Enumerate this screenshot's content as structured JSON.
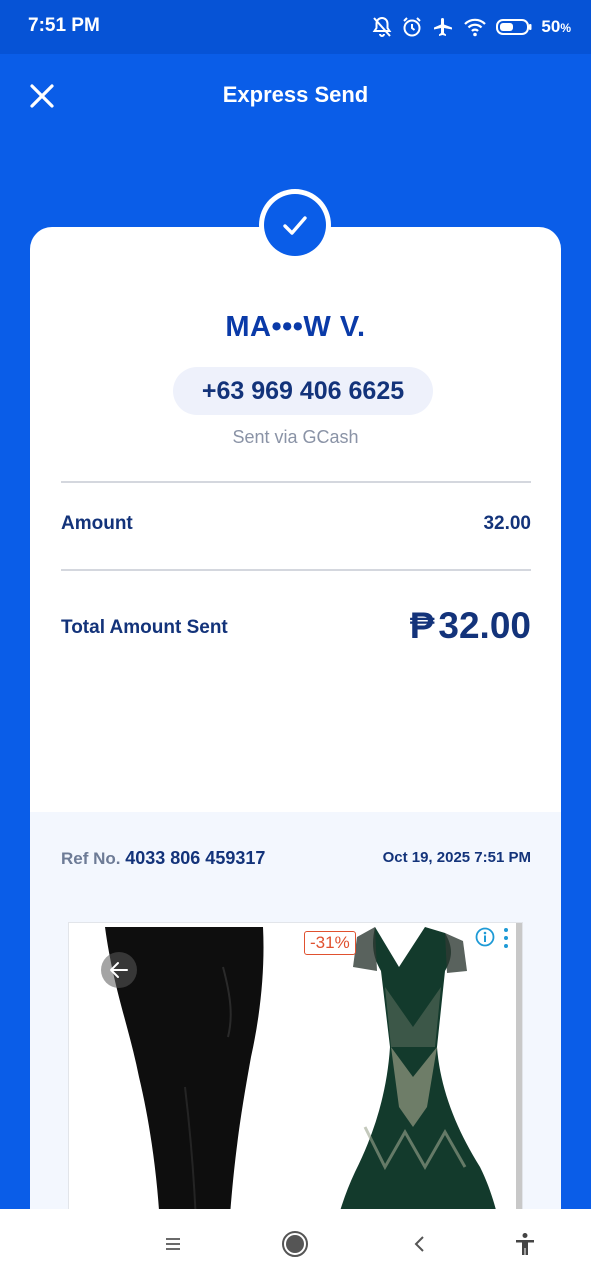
{
  "status_bar": {
    "time": "7:51 PM",
    "battery": "50",
    "battery_unit": "%"
  },
  "header": {
    "title": "Express Send"
  },
  "recipient": {
    "name": "MA•••W V.",
    "phone": "+63 969 406 6625",
    "sent_via": "Sent via GCash"
  },
  "amount_row": {
    "label": "Amount",
    "value": "32.00"
  },
  "total_row": {
    "label": "Total Amount Sent",
    "currency": "₱",
    "value": "32.00"
  },
  "reference": {
    "label": "Ref No.",
    "number": "4033 806 459317",
    "datetime": "Oct 19, 2025 7:51 PM"
  },
  "ad": {
    "discount": "-31%"
  },
  "icons": {
    "close": "close-icon",
    "check": "check-icon",
    "info": "info-icon",
    "menu": "more-vertical-icon",
    "back_arrow": "arrow-left-icon"
  },
  "colors": {
    "brand_blue": "#0a5de8",
    "status_bar_blue": "#0653d6",
    "navy_text": "#13337a",
    "name_blue": "#0a3aa8"
  }
}
